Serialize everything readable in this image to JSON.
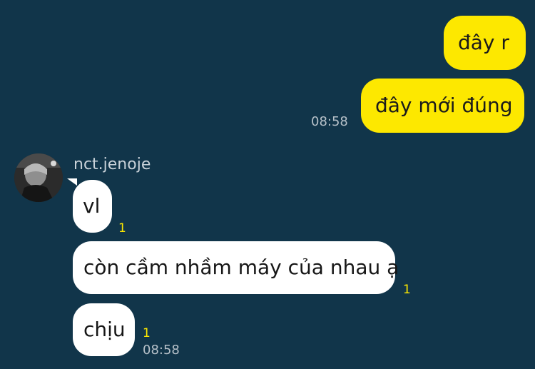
{
  "chat": {
    "outgoing": [
      {
        "text": "đây r"
      },
      {
        "text": "đây mới đúng",
        "time": "08:58"
      }
    ],
    "contact": {
      "name": "nct.jenoje"
    },
    "incoming": [
      {
        "text": "vl",
        "unread": "1"
      },
      {
        "text": "còn cầm nhầm máy của nhau ạ",
        "unread": "1"
      },
      {
        "text": "chịu",
        "unread": "1",
        "time": "08:58"
      }
    ]
  },
  "colors": {
    "background": "#11354a",
    "outgoing_bubble": "#fde800",
    "incoming_bubble": "#ffffff",
    "unread_badge": "#fde800",
    "timestamp": "#b7c1c9"
  }
}
